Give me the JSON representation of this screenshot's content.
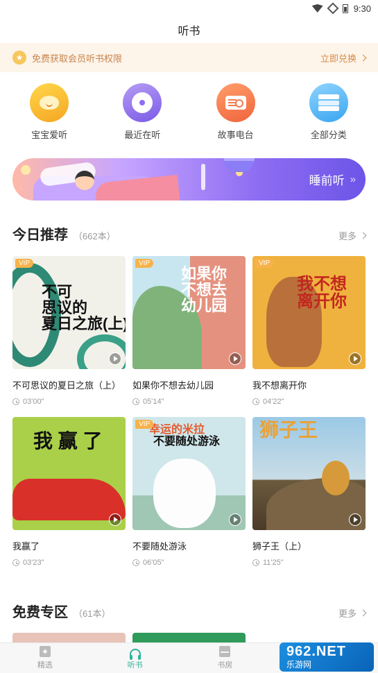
{
  "status_bar": {
    "time": "9:30"
  },
  "header": {
    "title": "听书"
  },
  "promo": {
    "text": "免费获取会员听书权限",
    "action": "立即兑换"
  },
  "quick_nav": [
    {
      "label": "宝宝爱听",
      "icon": "baby-face-icon"
    },
    {
      "label": "最近在听",
      "icon": "vinyl-disc-icon"
    },
    {
      "label": "故事电台",
      "icon": "radio-icon"
    },
    {
      "label": "全部分类",
      "icon": "category-box-icon"
    }
  ],
  "sleep_banner": {
    "label": "睡前听"
  },
  "today": {
    "title": "今日推荐",
    "count": "（662本）",
    "more": "更多",
    "books": [
      {
        "title": "不可思议的夏日之旅（上）",
        "duration": "03'00\"",
        "vip": "VIP",
        "cover_text": "不可\n思议的\n夏日之旅(上)"
      },
      {
        "title": "如果你不想去幼儿园",
        "duration": "05'14\"",
        "vip": "VIP",
        "cover_text": "如果你\n不想去\n幼儿园"
      },
      {
        "title": "我不想离开你",
        "duration": "04'22\"",
        "vip": "VIP",
        "cover_text": "我不想\n离开你"
      },
      {
        "title": "我赢了",
        "duration": "03'23\"",
        "vip": "",
        "cover_text": "我 赢 了"
      },
      {
        "title": "不要随处游泳",
        "duration": "06'05\"",
        "vip": "VIP",
        "cover_text": "不要随处游泳",
        "cover_sub": "幸运的米拉"
      },
      {
        "title": "狮子王（上）",
        "duration": "11'25\"",
        "vip": "",
        "cover_text": "狮子王"
      }
    ]
  },
  "free": {
    "title": "免费专区",
    "count": "（61本）",
    "more": "更多"
  },
  "tabs": [
    {
      "label": "精选",
      "icon": "featured-icon",
      "active": false
    },
    {
      "label": "听书",
      "icon": "headphone-icon",
      "active": true
    },
    {
      "label": "书房",
      "icon": "bookshelf-icon",
      "active": false
    }
  ],
  "watermark": {
    "main": "962.NET",
    "sub": "乐游网"
  },
  "colors": {
    "accent": "#2fb39b",
    "promo_text": "#c8854c",
    "vip": "#f7b24a"
  }
}
